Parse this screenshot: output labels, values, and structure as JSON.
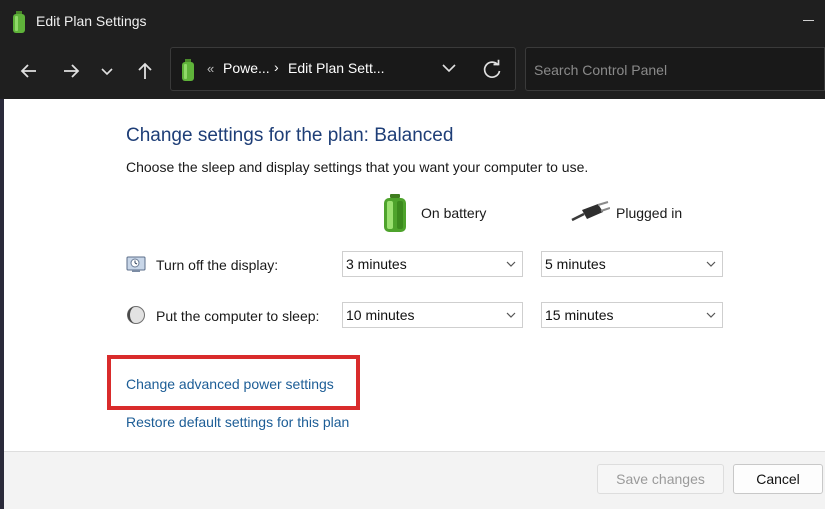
{
  "window": {
    "title": "Edit Plan Settings",
    "title_icon": "battery-icon"
  },
  "nav": {
    "back_icon": "back-arrow-icon",
    "forward_icon": "forward-arrow-icon",
    "recent_icon": "chevron-down-icon",
    "up_icon": "up-arrow-icon",
    "address": {
      "overflow": "«",
      "crumbs": [
        "Powe...",
        "Edit Plan Sett..."
      ],
      "separator": "›"
    },
    "refresh_icon": "refresh-icon",
    "search_placeholder": "Search Control Panel"
  },
  "content": {
    "heading": "Change settings for the plan: Balanced",
    "subtitle": "Choose the sleep and display settings that you want your computer to use.",
    "columns": {
      "battery": {
        "label": "On battery",
        "icon": "battery-icon"
      },
      "plugged": {
        "label": "Plugged in",
        "icon": "power-plug-icon"
      }
    },
    "rows": [
      {
        "label": "Turn off the display:",
        "icon": "display-icon",
        "battery": "3 minutes",
        "plugged": "5 minutes"
      },
      {
        "label": "Put the computer to sleep:",
        "icon": "moon-icon",
        "battery": "10 minutes",
        "plugged": "15 minutes"
      }
    ],
    "links": {
      "advanced": "Change advanced power settings",
      "restore": "Restore default settings for this plan"
    },
    "highlight_color": "#d92b2b"
  },
  "footer": {
    "save_label": "Save changes",
    "cancel_label": "Cancel"
  }
}
